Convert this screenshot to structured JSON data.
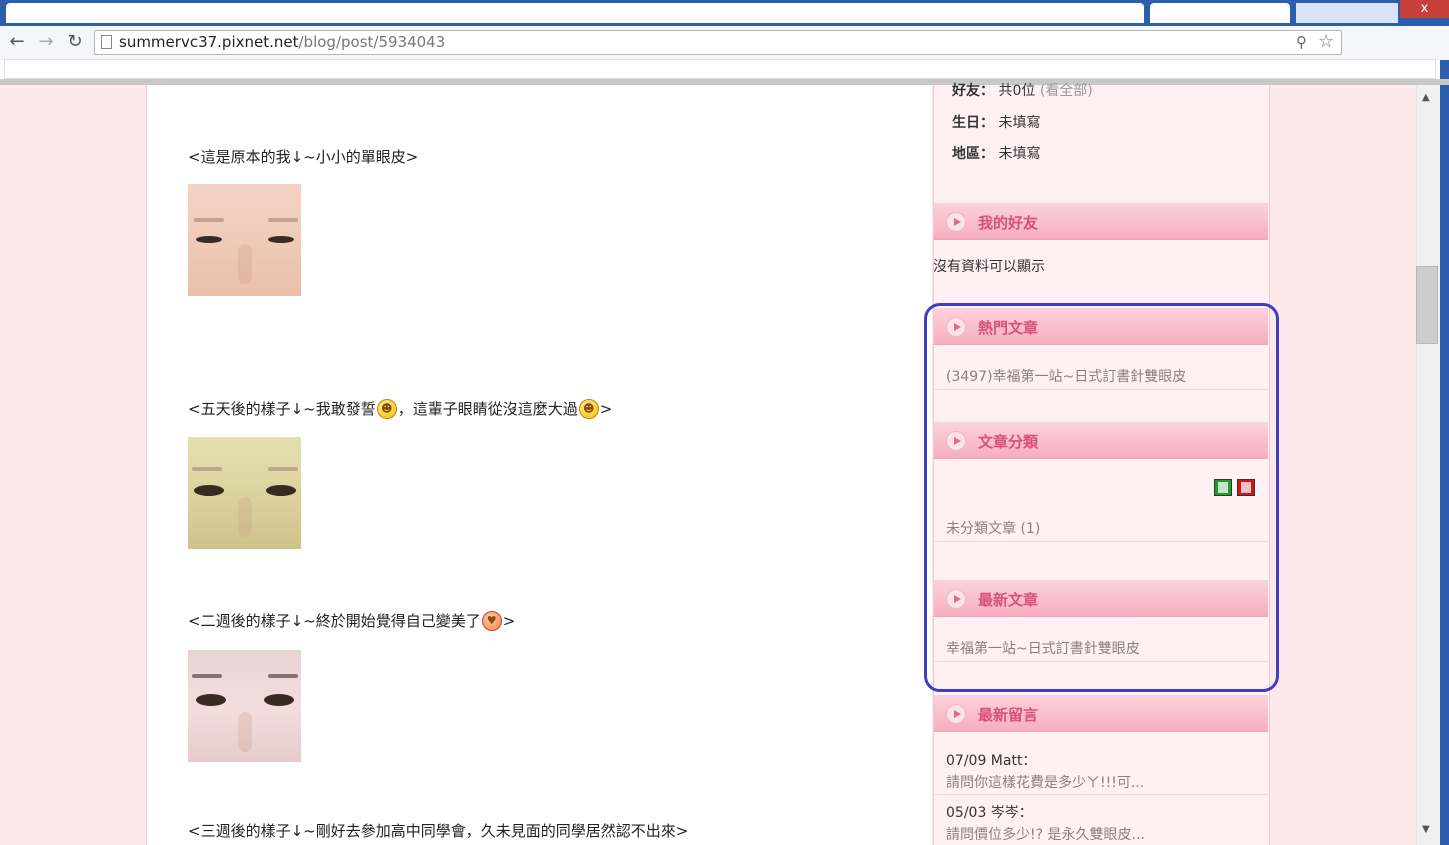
{
  "browser": {
    "url_domain": "summervc37.pixnet.net",
    "url_path": "/blog/post/5934043",
    "close_label": "x",
    "icons": {
      "back": "back-arrow-icon",
      "forward": "forward-arrow-icon",
      "reload": "reload-icon",
      "zoom": "zoom-icon",
      "star": "bookmark-star-icon"
    }
  },
  "post": {
    "captions": [
      {
        "text": "<這是原本的我↓~小小的單眼皮>"
      },
      {
        "text_a": "<五天後的樣子↓~我敢發誓",
        "text_b": "，這輩子眼睛從沒這麼大過",
        "text_c": ">"
      },
      {
        "text_a": "<二週後的樣子↓~終於開始覺得自己變美了",
        "text_c": ">"
      },
      {
        "text": "<三週後的樣子↓~剛好去參加高中同學會，久未見面的同學居然認不出來>"
      }
    ],
    "photos": [
      "eye-photo-original",
      "eye-photo-day5",
      "eye-photo-week2"
    ]
  },
  "sidebar": {
    "profile": {
      "friends_label": "好友：",
      "friends_value": "共0位",
      "friends_link": "(看全部)",
      "birthday_label": "生日：",
      "birthday_value": "未填寫",
      "region_label": "地區：",
      "region_value": "未填寫"
    },
    "my_friends": {
      "title": "我的好友",
      "empty": "沒有資料可以顯示"
    },
    "popular": {
      "title": "熱門文章",
      "items": [
        "(3497)幸福第一站~日式訂書針雙眼皮"
      ]
    },
    "categories": {
      "title": "文章分類",
      "items": [
        "未分類文章 (1)"
      ]
    },
    "latest_posts": {
      "title": "最新文章",
      "items": [
        "幸福第一站~日式訂書針雙眼皮"
      ]
    },
    "latest_comments": {
      "title": "最新留言",
      "items": [
        {
          "who": "07/09 Matt：",
          "text": "請問你這樣花費是多少ㄚ!!!可..."
        },
        {
          "who": "05/03 岑岑：",
          "text": "請問價位多少!? 是永久雙眼皮..."
        }
      ]
    }
  },
  "colors": {
    "accent_pink": "#d9507a",
    "highlight": "#3e3fbf",
    "page_bg": "#fde9ec"
  }
}
